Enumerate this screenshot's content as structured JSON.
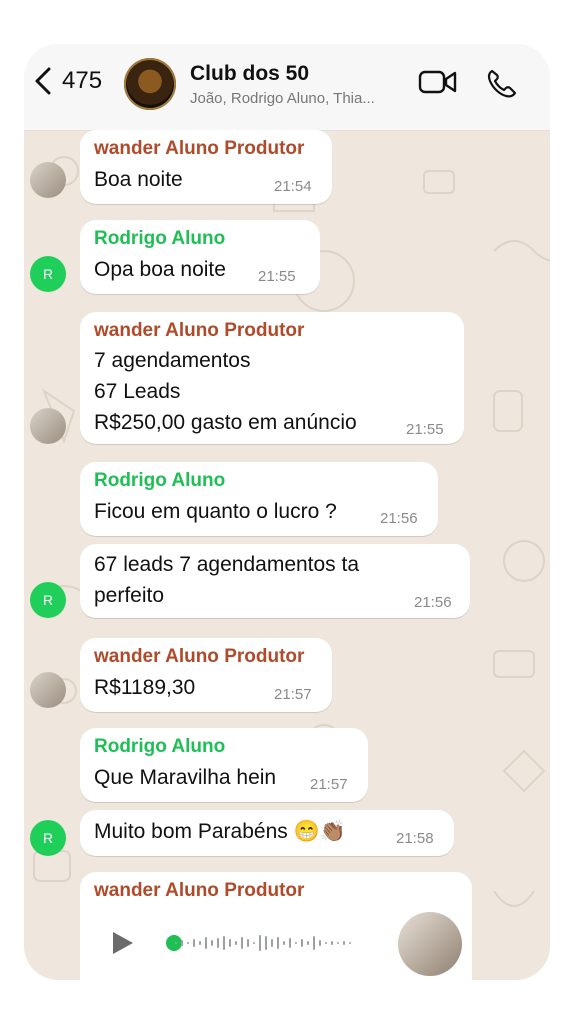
{
  "header": {
    "back_count": "475",
    "title": "Club dos 50",
    "members": "João, Rodrigo Aluno, Thia..."
  },
  "icons": {
    "back": "chevron-left-icon",
    "video": "video-camera-icon",
    "phone": "phone-icon",
    "play": "play-icon",
    "mic": "microphone-icon"
  },
  "colors": {
    "wander_name": "#b04a2a",
    "rodrigo_name": "#1fbf56",
    "chat_background": "#efe7dd",
    "bubble": "#ffffff"
  },
  "messages": [
    {
      "sender": "wander Aluno Produtor",
      "text": "Boa noite",
      "time": "21:54"
    },
    {
      "sender": "Rodrigo Aluno",
      "text": "Opa boa noite",
      "time": "21:55",
      "avatar_letter": "R"
    },
    {
      "sender": "wander Aluno Produtor",
      "lines": [
        "7 agendamentos",
        "67 Leads",
        "R$250,00 gasto em anúncio"
      ],
      "time": "21:55"
    },
    {
      "sender": "Rodrigo Aluno",
      "text": "Ficou em quanto o lucro ?",
      "time": "21:56"
    },
    {
      "text": "67 leads 7 agendamentos ta\nperfeito",
      "time": "21:56",
      "avatar_letter": "R"
    },
    {
      "sender": "wander Aluno Produtor",
      "text": "R$1189,30",
      "time": "21:57"
    },
    {
      "sender": "Rodrigo Aluno",
      "text": "Que Maravilha hein",
      "time": "21:57"
    },
    {
      "text": "Muito bom Parabéns 😁👏🏽",
      "time": "21:58",
      "avatar_letter": "R"
    },
    {
      "sender": "wander Aluno Produtor",
      "type": "voice",
      "progress": 0
    }
  ]
}
